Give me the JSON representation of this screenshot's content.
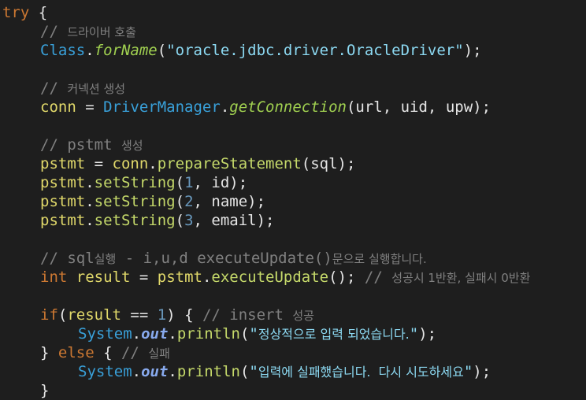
{
  "colors": {
    "background": "#1e1e1e",
    "keyword": "#cc7832",
    "comment": "#808080",
    "class": "#39a0d9",
    "method": "#a0d050",
    "string": "#8cd9f2",
    "variable": "#e0d86a",
    "number": "#6897bb"
  },
  "code": {
    "l1_kw": "try",
    "l1_rest": " {",
    "l2_cmt": "// ",
    "l2_cmt_kr": "드라이버 호출",
    "l3_cls": "Class",
    "l3_dot": ".",
    "l3_fn": "forName",
    "l3_open": "(",
    "l3_str": "\"oracle.jdbc.driver.OracleDriver\"",
    "l3_close": ");",
    "l5_cmt": "// ",
    "l5_cmt_kr": "커넥션 생성",
    "l6_var": "conn",
    "l6_eq": " = ",
    "l6_cls": "DriverManager",
    "l6_dot": ".",
    "l6_fn": "getConnection",
    "l6_rest": "(url, uid, upw);",
    "l8_cmt": "// pstmt ",
    "l8_cmt_kr": "생성",
    "l9_var": "pstmt",
    "l9_eq": " = ",
    "l9_var2": "conn",
    "l9_dot": ".",
    "l9_fn": "prepareStatement",
    "l9_rest": "(sql);",
    "l10_var": "pstmt",
    "l10_dot": ".",
    "l10_fn": "setString",
    "l10_open": "(",
    "l10_num": "1",
    "l10_rest": ", id);",
    "l11_var": "pstmt",
    "l11_dot": ".",
    "l11_fn": "setString",
    "l11_open": "(",
    "l11_num": "2",
    "l11_rest": ", name);",
    "l12_var": "pstmt",
    "l12_dot": ".",
    "l12_fn": "setString",
    "l12_open": "(",
    "l12_num": "3",
    "l12_rest": ", email);",
    "l14_cmt": "// sql",
    "l14_cmt_kr1": "실행",
    "l14_cmt2": " - i,u,d executeUpdate()",
    "l14_cmt_kr2": "문으로 실행합니다.",
    "l15_kw": "int",
    "l15_sp": " ",
    "l15_var": "result",
    "l15_eq": " = ",
    "l15_var2": "pstmt",
    "l15_dot": ".",
    "l15_fn": "executeUpdate",
    "l15_rest": "(); ",
    "l15_cmt": "// ",
    "l15_cmt_kr": "성공시 1반환, 실패시 0반환",
    "l17_kw": "if",
    "l17_open": "(",
    "l17_var": "result",
    "l17_eq": " == ",
    "l17_num": "1",
    "l17_rest": ") { ",
    "l17_cmt": "// insert ",
    "l17_cmt_kr": "성공",
    "l18_cls": "System",
    "l18_dot": ".",
    "l18_fld": "out",
    "l18_dot2": ".",
    "l18_fn": "println",
    "l18_open": "(",
    "l18_str_q1": "\"",
    "l18_str_kr": "정상적으로 입력 되었습니다.",
    "l18_str_q2": "\"",
    "l18_close": ");",
    "l19_brace": "} ",
    "l19_kw": "else",
    "l19_rest": " { ",
    "l19_cmt": "// ",
    "l19_cmt_kr": "실패",
    "l20_cls": "System",
    "l20_dot": ".",
    "l20_fld": "out",
    "l20_dot2": ".",
    "l20_fn": "println",
    "l20_open": "(",
    "l20_str_q1": "\"",
    "l20_str_kr": "입력에 실패했습니다.  다시 시도하세요",
    "l20_str_q2": "\"",
    "l20_close": ");",
    "l21_brace": "}"
  }
}
